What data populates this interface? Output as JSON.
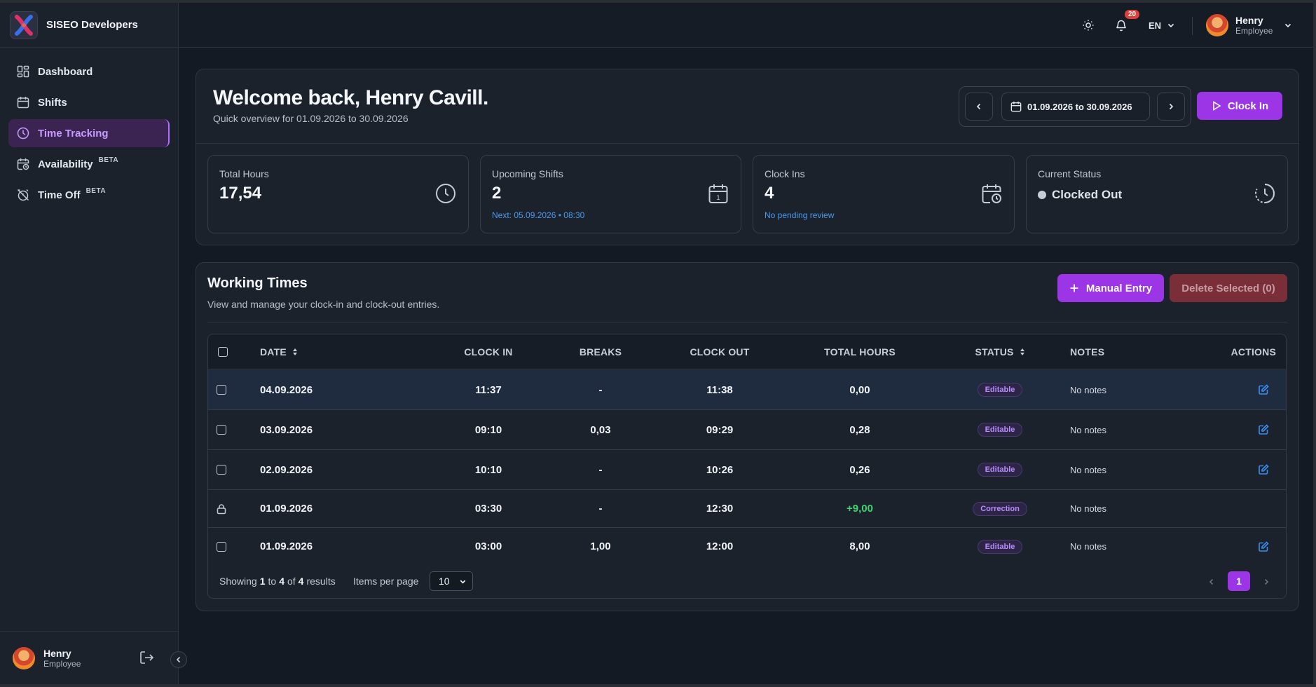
{
  "sidebar": {
    "brand": "SISEO Developers",
    "items": [
      {
        "label": "Dashboard",
        "icon": "dashboard-icon"
      },
      {
        "label": "Shifts",
        "icon": "calendar-icon"
      },
      {
        "label": "Time Tracking",
        "icon": "clock-icon",
        "active": true
      },
      {
        "label": "Availability",
        "icon": "calendar-clock-icon",
        "beta": "BETA"
      },
      {
        "label": "Time Off",
        "icon": "alarm-off-icon",
        "beta": "BETA"
      }
    ],
    "user": {
      "name": "Henry",
      "role": "Employee"
    }
  },
  "topbar": {
    "notifications": "20",
    "language": "EN",
    "user": {
      "name": "Henry",
      "role": "Employee"
    }
  },
  "header": {
    "welcome": "Welcome back, Henry Cavill.",
    "subtitle": "Quick overview for 01.09.2026 to 30.09.2026",
    "date_range": "01.09.2026 to 30.09.2026",
    "clock_in_label": "Clock In"
  },
  "stats": [
    {
      "label": "Total Hours",
      "value": "17,54",
      "note": ""
    },
    {
      "label": "Upcoming Shifts",
      "value": "2",
      "note": "Next: 05.09.2026 • 08:30"
    },
    {
      "label": "Clock Ins",
      "value": "4",
      "note": "No pending review"
    },
    {
      "label": "Current Status",
      "value": "Clocked Out",
      "note": ""
    }
  ],
  "working_times": {
    "title": "Working Times",
    "subtitle": "View and manage your clock-in and clock-out entries.",
    "manual_entry_label": "Manual Entry",
    "delete_selected_label": "Delete Selected (0)",
    "columns": [
      "DATE",
      "CLOCK IN",
      "BREAKS",
      "CLOCK OUT",
      "TOTAL HOURS",
      "STATUS",
      "NOTES",
      "ACTIONS"
    ],
    "rows": [
      {
        "date": "04.09.2026",
        "clock_in": "11:37",
        "breaks": "-",
        "clock_out": "11:38",
        "total": "0,00",
        "status": "Editable",
        "notes": "No notes",
        "locked": false
      },
      {
        "date": "03.09.2026",
        "clock_in": "09:10",
        "breaks": "0,03",
        "clock_out": "09:29",
        "total": "0,28",
        "status": "Editable",
        "notes": "No notes",
        "locked": false
      },
      {
        "date": "02.09.2026",
        "clock_in": "10:10",
        "breaks": "-",
        "clock_out": "10:26",
        "total": "0,26",
        "status": "Editable",
        "notes": "No notes",
        "locked": false
      },
      {
        "date": "01.09.2026",
        "clock_in": "03:30",
        "breaks": "-",
        "clock_out": "12:30",
        "total": "+9,00",
        "status": "Correction",
        "notes": "No notes",
        "locked": true
      },
      {
        "date": "01.09.2026",
        "clock_in": "03:00",
        "breaks": "1,00",
        "clock_out": "12:00",
        "total": "8,00",
        "status": "Editable",
        "notes": "No notes",
        "locked": false
      }
    ],
    "footer": {
      "showing_prefix": "Showing",
      "from": "1",
      "to_word": "to",
      "to": "4",
      "of_word": "of",
      "total": "4",
      "results_word": "results",
      "items_per_page_label": "Items per page",
      "items_per_page": "10",
      "current_page": "1"
    }
  }
}
